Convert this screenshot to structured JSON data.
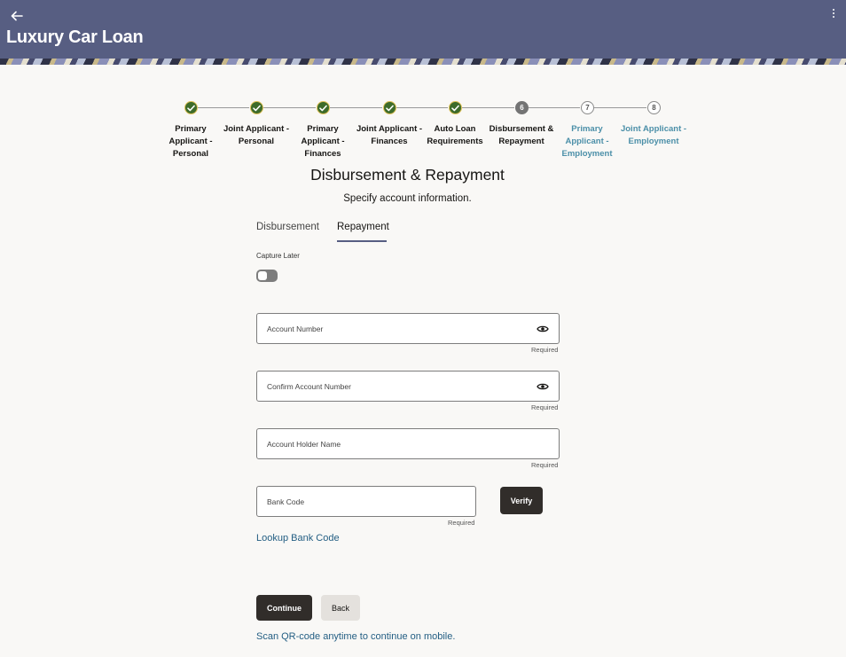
{
  "header": {
    "title": "Luxury Car Loan"
  },
  "stepper": {
    "steps": [
      {
        "label": "Primary Applicant - Personal",
        "status": "done",
        "number": ""
      },
      {
        "label": "Joint Applicant - Personal",
        "status": "done",
        "number": ""
      },
      {
        "label": "Primary Applicant - Finances",
        "status": "done",
        "number": ""
      },
      {
        "label": "Joint Applicant - Finances",
        "status": "done",
        "number": ""
      },
      {
        "label": "Auto Loan Requirements",
        "status": "done",
        "number": ""
      },
      {
        "label": "Disbursement & Repayment",
        "status": "current",
        "number": "6"
      },
      {
        "label": "Primary Applicant - Employment",
        "status": "todo",
        "number": "7"
      },
      {
        "label": "Joint Applicant - Employment",
        "status": "todo",
        "number": "8"
      }
    ]
  },
  "main": {
    "title": "Disbursement & Repayment",
    "subtitle": "Specify account information.",
    "tabs": [
      {
        "label": "Disbursement",
        "active": false
      },
      {
        "label": "Repayment",
        "active": true
      }
    ],
    "capture_later_label": "Capture Later",
    "capture_later_on": false,
    "fields": {
      "account_number": {
        "placeholder": "Account Number",
        "hint": "Required"
      },
      "confirm_account_number": {
        "placeholder": "Confirm Account Number",
        "hint": "Required"
      },
      "account_holder_name": {
        "placeholder": "Account Holder Name",
        "hint": "Required"
      },
      "bank_code": {
        "placeholder": "Bank Code",
        "hint": "Required"
      }
    },
    "verify_label": "Verify",
    "lookup_link": "Lookup Bank Code",
    "continue_label": "Continue",
    "back_label": "Back",
    "qr_link": "Scan QR-code anytime to continue on mobile."
  },
  "colors": {
    "header": "#575e82",
    "done": "#3d6b2a",
    "link": "#235e83",
    "primary_button": "#312d2a"
  },
  "icons": [
    "back-arrow-icon",
    "more-vertical-icon",
    "check-icon",
    "eye-icon"
  ]
}
